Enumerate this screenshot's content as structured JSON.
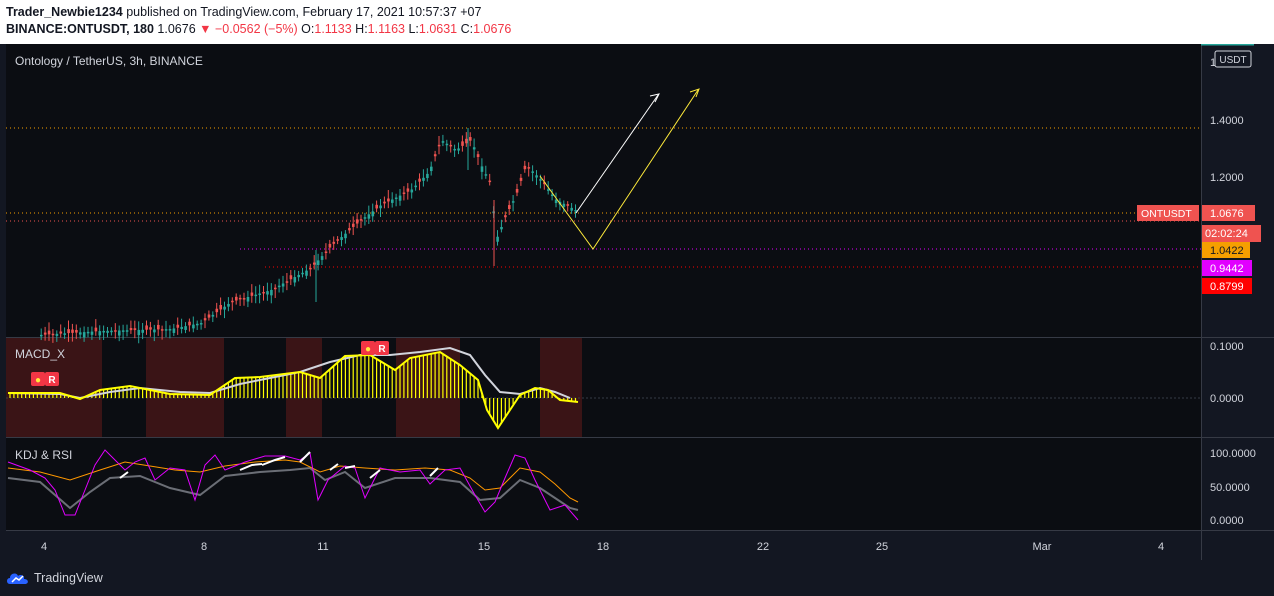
{
  "header": {
    "publisher": "Trader_Newbie1234",
    "published_text": "published on TradingView.com, February 17, 2021 10:57:37 +07",
    "symbol_line": "BINANCE:ONTUSDT, 180",
    "last": "1.0676",
    "change": "▼ −0.0562 (−5%)",
    "o_label": "O:",
    "o": "1.1133",
    "h_label": "H:",
    "h": "1.1163",
    "l_label": "L:",
    "l": "1.0631",
    "c_label": "C:",
    "c": "1.0676"
  },
  "chart": {
    "legend": "Ontology / TetherUS, 3h, BINANCE",
    "currency": "USDT",
    "price_axis": [
      "1",
      "1.4000",
      "1.2000"
    ],
    "price_labels": [
      {
        "text": "ONTUSDT",
        "value": "1.0676",
        "color": "#ef5350"
      },
      {
        "text": "",
        "value": "02:02:24",
        "color": "#ef5350"
      },
      {
        "text": "",
        "value": "1.0422",
        "color": "#f59f00"
      },
      {
        "text": "",
        "value": "0.9442",
        "color": "#e100ff"
      },
      {
        "text": "",
        "value": "0.8799",
        "color": "#ff0000"
      }
    ]
  },
  "macd": {
    "label": "MACD_X",
    "axis": [
      "0.1000",
      "0.0000"
    ],
    "badge": "R"
  },
  "kdj": {
    "label": "KDJ & RSI",
    "axis": [
      "100.0000",
      "50.0000",
      "0.0000"
    ]
  },
  "time_axis": [
    "4",
    "8",
    "11",
    "15",
    "18",
    "22",
    "25",
    "Mar",
    "4"
  ],
  "footer": {
    "brand": "TradingView"
  },
  "colors": {
    "up": "#26a69a",
    "down": "#ef5350",
    "macd": "#ffff00",
    "signal": "#b2b5be",
    "rsi": "#ff9800",
    "k": "#e100ff"
  }
}
